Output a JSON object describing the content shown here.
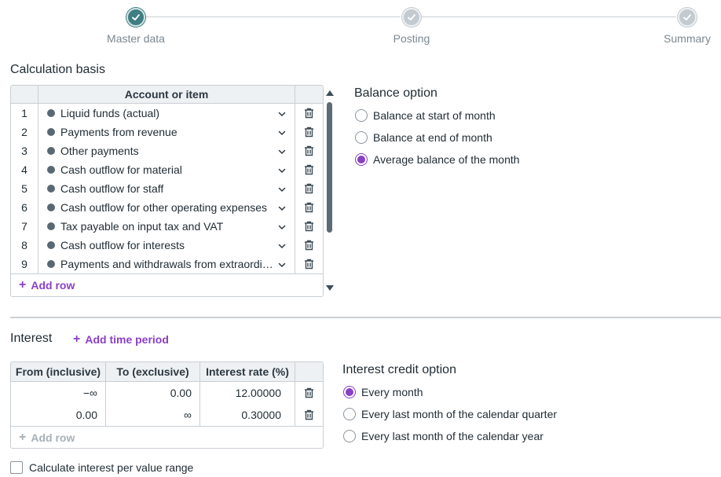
{
  "stepper": {
    "steps": [
      {
        "label": "Master data",
        "state": "done"
      },
      {
        "label": "Posting",
        "state": "pending"
      },
      {
        "label": "Summary",
        "state": "pending"
      }
    ]
  },
  "calculation_basis": {
    "title": "Calculation basis",
    "column_header": "Account or item",
    "rows": [
      {
        "num": "1",
        "label": "Liquid funds (actual)"
      },
      {
        "num": "2",
        "label": "Payments from revenue"
      },
      {
        "num": "3",
        "label": "Other payments"
      },
      {
        "num": "4",
        "label": "Cash outflow for material"
      },
      {
        "num": "5",
        "label": "Cash outflow for staff"
      },
      {
        "num": "6",
        "label": "Cash outflow for other operating expenses"
      },
      {
        "num": "7",
        "label": "Tax payable on input tax and VAT"
      },
      {
        "num": "8",
        "label": "Cash outflow for interests"
      },
      {
        "num": "9",
        "label": "Payments and withdrawals from extraordi…"
      }
    ],
    "add_row_label": "Add row"
  },
  "balance_option": {
    "title": "Balance option",
    "options": [
      {
        "label": "Balance at start of month",
        "checked": false
      },
      {
        "label": "Balance at end of month",
        "checked": false
      },
      {
        "label": "Average balance of the month",
        "checked": true
      }
    ]
  },
  "interest": {
    "title": "Interest",
    "add_period_label": "Add time period",
    "columns": [
      "From (inclusive)",
      "To (exclusive)",
      "Interest rate (%)"
    ],
    "rows": [
      {
        "from": "−∞",
        "to": "0.00",
        "rate": "12.00000"
      },
      {
        "from": "0.00",
        "to": "∞",
        "rate": "0.30000"
      }
    ],
    "add_row_label": "Add row"
  },
  "interest_credit_option": {
    "title": "Interest credit option",
    "options": [
      {
        "label": "Every month",
        "checked": true
      },
      {
        "label": "Every last month of the calendar quarter",
        "checked": false
      },
      {
        "label": "Every last month of the calendar year",
        "checked": false
      }
    ]
  },
  "value_range_checkbox": {
    "label": "Calculate interest per value range",
    "checked": false
  },
  "colors": {
    "accent": "#8a3fc7",
    "step_done": "#3f7e82",
    "step_pending": "#c4cbd0"
  }
}
